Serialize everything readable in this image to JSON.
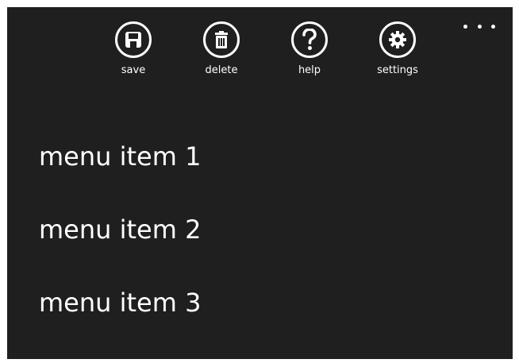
{
  "app_bar": {
    "background": "#1f1f1f",
    "foreground": "#ffffff",
    "buttons": [
      {
        "label": "save",
        "icon": "save-icon"
      },
      {
        "label": "delete",
        "icon": "delete-icon"
      },
      {
        "label": "help",
        "icon": "help-icon"
      },
      {
        "label": "settings",
        "icon": "settings-icon"
      }
    ],
    "more_icon": "ellipsis-icon",
    "menu_items": [
      {
        "label": "menu item 1"
      },
      {
        "label": "menu item 2"
      },
      {
        "label": "menu item 3"
      }
    ]
  }
}
